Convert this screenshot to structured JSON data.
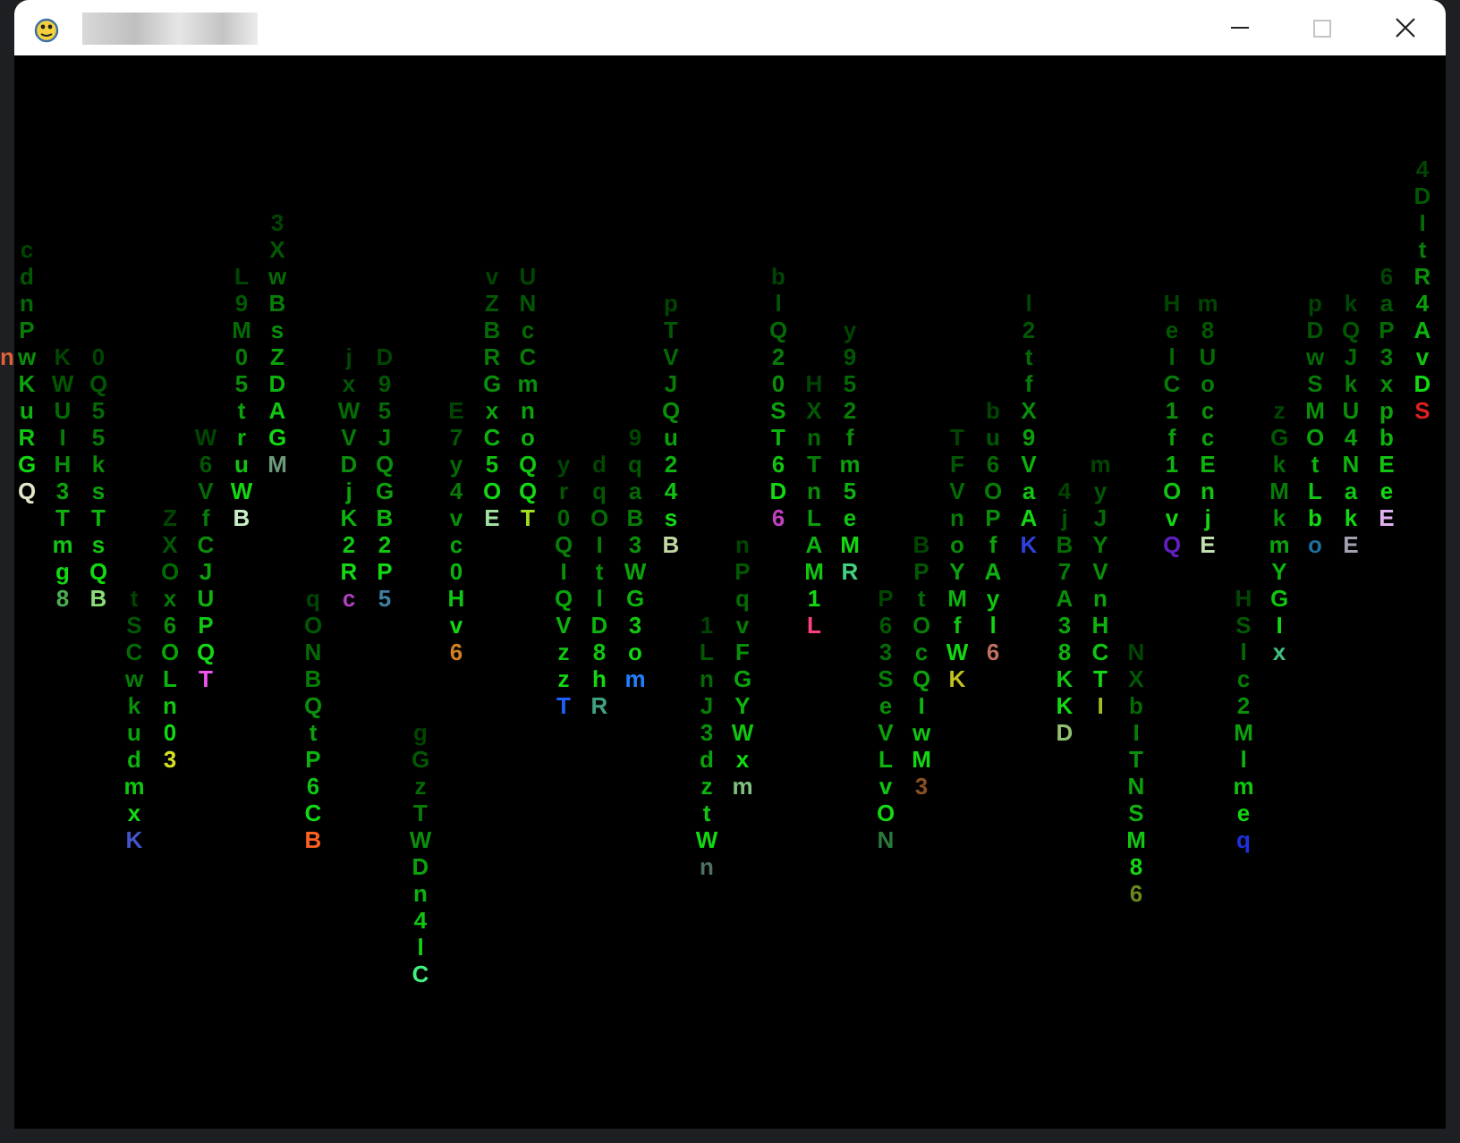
{
  "window": {
    "maximize_disabled": true
  },
  "backdrop_glyph": "n",
  "rain": [
    {
      "glyphs": "       cdnPwKuRGQ",
      "color": "#e0e8c8"
    },
    {
      "glyphs": "           KWUIH3Tmg8",
      "color": "#4caf50"
    },
    {
      "glyphs": "           0Q55ksTsQB",
      "color": "#88dd77"
    },
    {
      "glyphs": "                    tSCwkudmxK",
      "color": "#4455cc"
    },
    {
      "glyphs": "                 ZXOx6OLn03",
      "color": "#d6e020"
    },
    {
      "glyphs": "              W6VfCJUPQT",
      "color": "#ee55ee"
    },
    {
      "glyphs": "        L9M05truWB",
      "color": "#c8f0c8"
    },
    {
      "glyphs": "      3XwBsZDAGM",
      "color": "#6a9a7a"
    },
    {
      "glyphs": "                    qONBQtP6CB",
      "color": "#ff6020"
    },
    {
      "glyphs": "           jxWVDjK2Rc",
      "color": "#b040c0"
    },
    {
      "glyphs": "           D95JQGB2P5",
      "color": "#4080a0"
    },
    {
      "glyphs": "                         gGzTWDn4lC",
      "color": "#40f080"
    },
    {
      "glyphs": "             E7y4vc0Hv6",
      "color": "#d08020"
    },
    {
      "glyphs": "        vZBRGxC5OE",
      "color": "#a0e0a0"
    },
    {
      "glyphs": "        UNcCmnoQQT",
      "color": "#a0e020"
    },
    {
      "glyphs": "               yr0QIQVzzT",
      "color": "#2060ff"
    },
    {
      "glyphs": "               dqOItlD8hR",
      "color": "#40a080"
    },
    {
      "glyphs": "              9qaB3WG3om",
      "color": "#2080ff"
    },
    {
      "glyphs": "         pTVJQu24sB",
      "color": "#c0d8a0"
    },
    {
      "glyphs": "                     1LnJ3dztWn",
      "color": "#507060"
    },
    {
      "glyphs": "                  nPqvFGYWxm",
      "color": "#80c080"
    },
    {
      "glyphs": "        blQ20ST6D6",
      "color": "#c040c0"
    },
    {
      "glyphs": "            HXnTnLAM1L",
      "color": "#ff4080"
    },
    {
      "glyphs": "          y952fm5eMR",
      "color": "#40d080"
    },
    {
      "glyphs": "                    P63SeVLvON",
      "color": "#2a7a3a"
    },
    {
      "glyphs": "                  BPtOcQIwM3",
      "color": "#8a5020"
    },
    {
      "glyphs": "              TFVnoYMfWK",
      "color": "#c0c020"
    },
    {
      "glyphs": "             bu6OPfAyl6",
      "color": "#c07060"
    },
    {
      "glyphs": "         l2tfX9VaAK",
      "color": "#3040e0"
    },
    {
      "glyphs": "                4jB7A38KKD",
      "color": "#90c070"
    },
    {
      "glyphs": "               myJYVnHCTI",
      "color": "#a0c020"
    },
    {
      "glyphs": "                      NXbITNSM86",
      "color": "#6a8a20"
    },
    {
      "glyphs": "         HelC1f1OvQ",
      "color": "#6020c0"
    },
    {
      "glyphs": "         m8UoccEnjE",
      "color": "#c0e0b0"
    },
    {
      "glyphs": "                    HSlc2Mlmeq",
      "color": "#2030e0"
    },
    {
      "glyphs": "             zGkMkmYGIx",
      "color": "#40c080"
    },
    {
      "glyphs": "         pDwSMOtLbo",
      "color": "#2070a0"
    },
    {
      "glyphs": "         kQJkU4NakE",
      "color": "#a0a0b0"
    },
    {
      "glyphs": "        6aP3xpbEeE",
      "color": "#e0b0f0"
    },
    {
      "glyphs": "    4DItR4AvDS",
      "color": "#e02020"
    }
  ]
}
